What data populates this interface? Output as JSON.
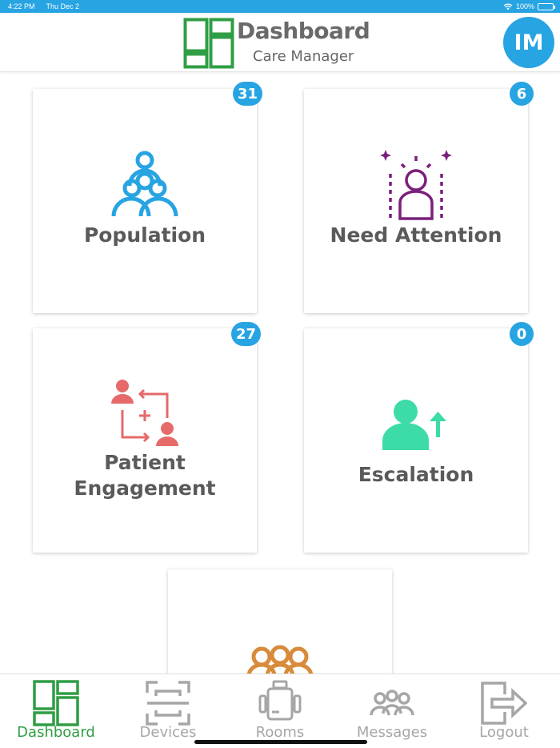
{
  "status_bar": {
    "time": "4:22 PM",
    "date": "Thu Dec 2",
    "battery": "100%"
  },
  "header": {
    "title": "Dashboard",
    "subtitle": "Care Manager",
    "avatar_initials": "IM"
  },
  "cards": [
    {
      "label": "Population",
      "badge": "31",
      "icon": "population-icon",
      "color": "#27a4e2"
    },
    {
      "label": "Need Attention",
      "badge": "6",
      "icon": "attention-person-icon",
      "color": "#7b1f7d"
    },
    {
      "label_line1": "Patient",
      "label_line2": "Engagement",
      "badge": "27",
      "icon": "patient-engagement-icon",
      "color": "#e66a6a"
    },
    {
      "label": "Escalation",
      "badge": "0",
      "icon": "escalation-icon",
      "color": "#3ddba8"
    },
    {
      "icon": "group-icon",
      "color": "#d88b3a"
    }
  ],
  "tabs": [
    {
      "label": "Dashboard",
      "icon": "dashboard-icon",
      "active": true
    },
    {
      "label": "Devices",
      "icon": "scan-device-icon",
      "active": false
    },
    {
      "label": "Rooms",
      "icon": "room-icon",
      "active": false
    },
    {
      "label": "Messages",
      "icon": "messages-group-icon",
      "active": false
    },
    {
      "label": "Logout",
      "icon": "logout-icon",
      "active": false
    }
  ],
  "colors": {
    "accent": "#27a4e2",
    "brand_green": "#2f9e44",
    "tab_inactive": "#a6a6a6"
  }
}
